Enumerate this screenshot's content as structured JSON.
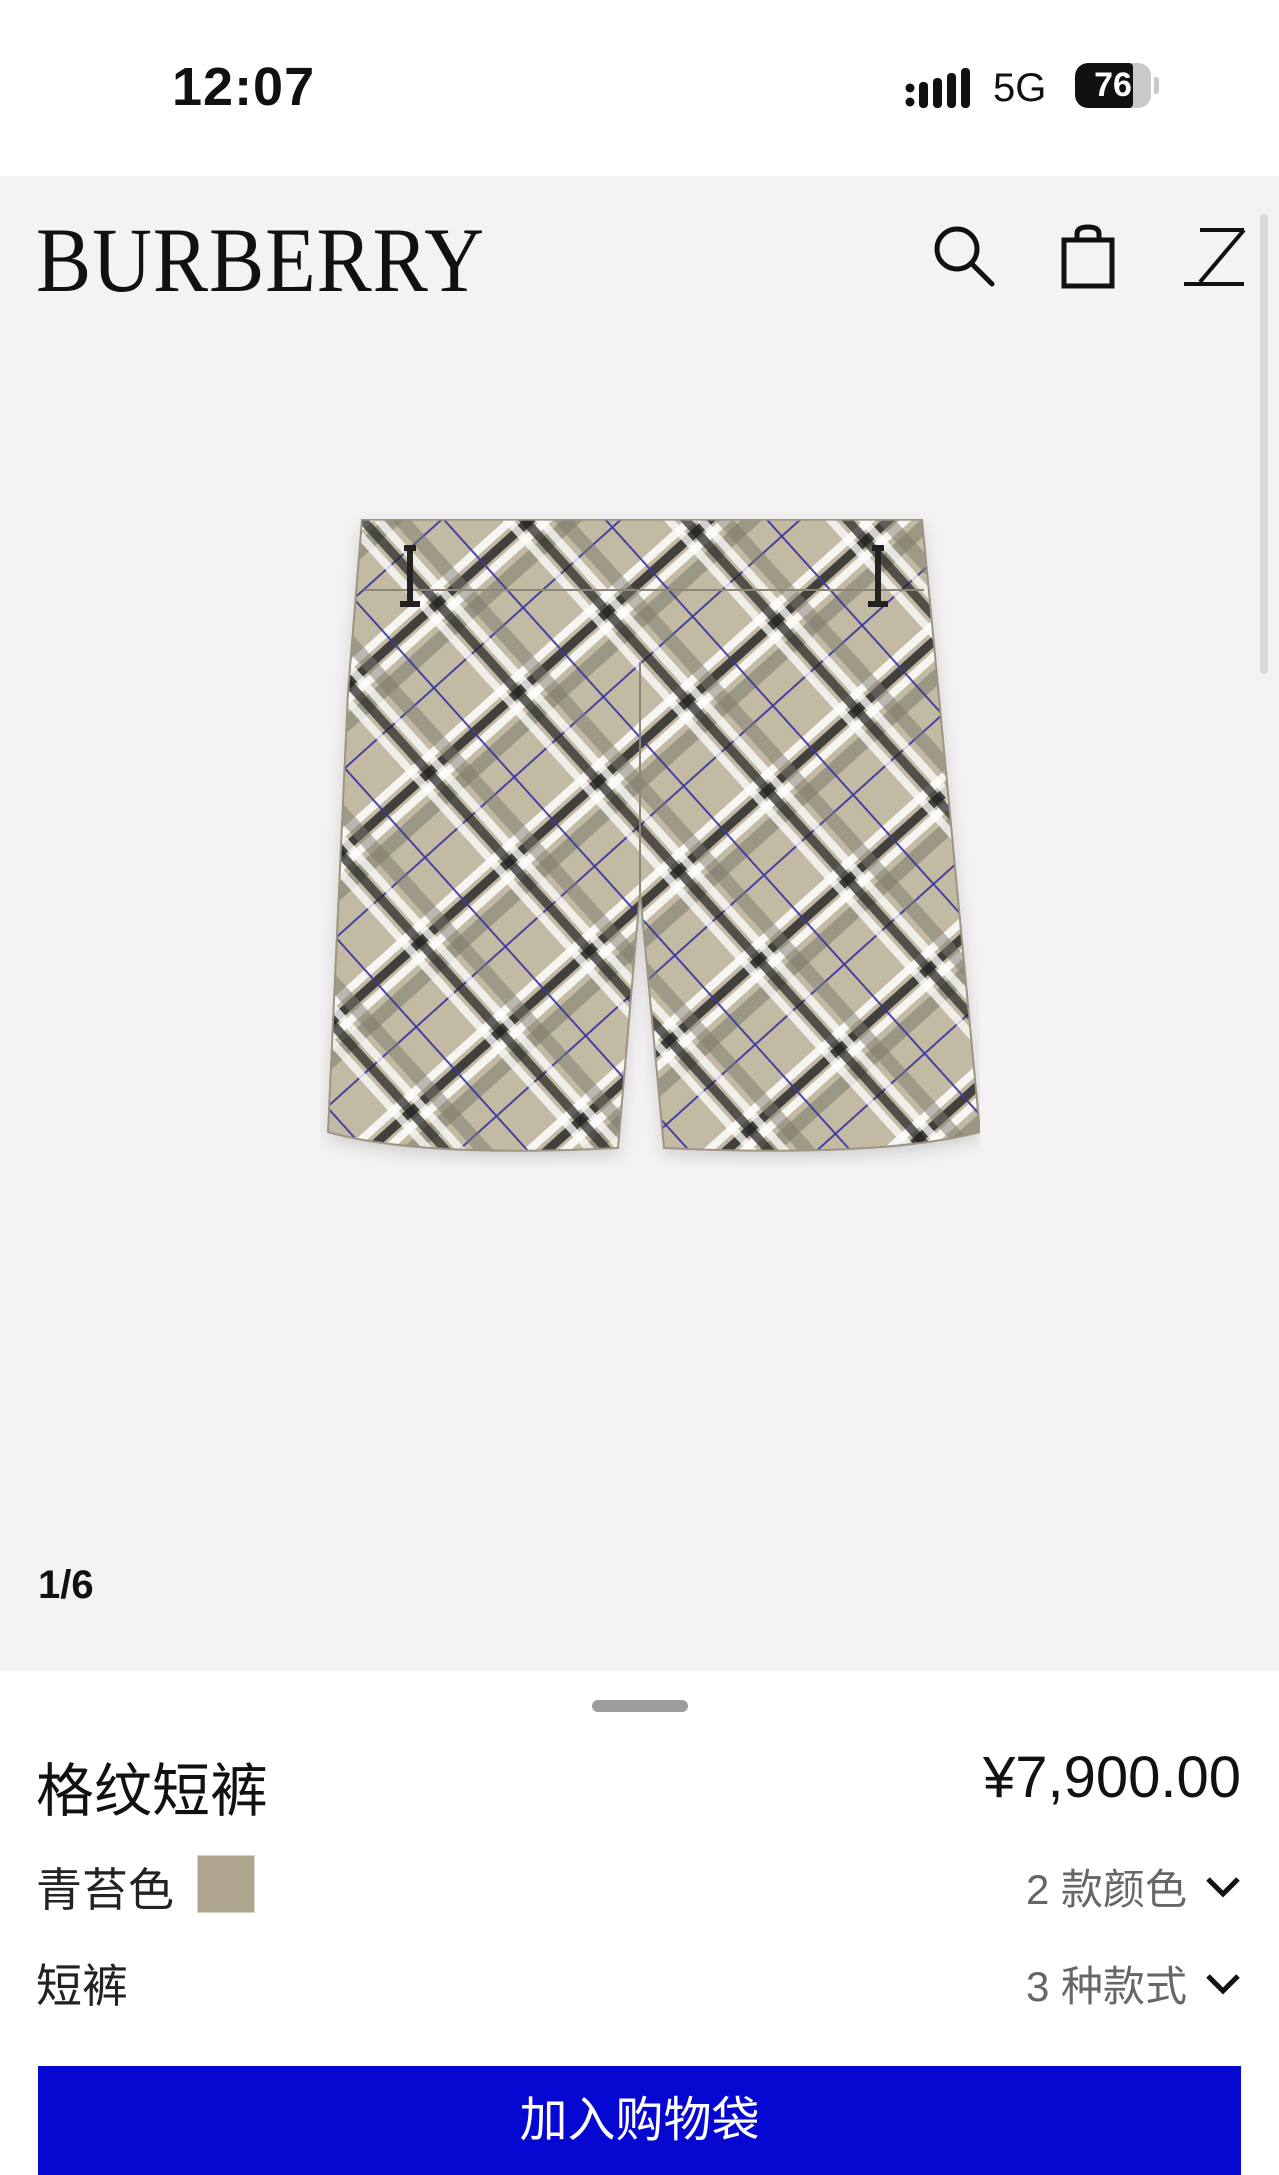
{
  "status_bar": {
    "time": "12:07",
    "network": "5G",
    "battery_level": "76",
    "battery_fraction": 0.76
  },
  "header": {
    "logo": "BURBERRY",
    "icons": [
      "search-icon",
      "shopping-bag-icon",
      "menu-icon"
    ]
  },
  "gallery": {
    "counter": "1/6",
    "image": "checked-shorts-product-image"
  },
  "product": {
    "name": "格纹短裤",
    "price": "¥7,900.00",
    "color_name": "青苔色",
    "color_swatch": "#afa48d",
    "color_options": "2 款颜色",
    "style_name": "短裤",
    "style_options": "3 种款式"
  },
  "actions": {
    "add_to_bag": "加入购物袋"
  },
  "colors": {
    "accent": "#0707d2",
    "gallery_bg": "#f4f3f3"
  }
}
